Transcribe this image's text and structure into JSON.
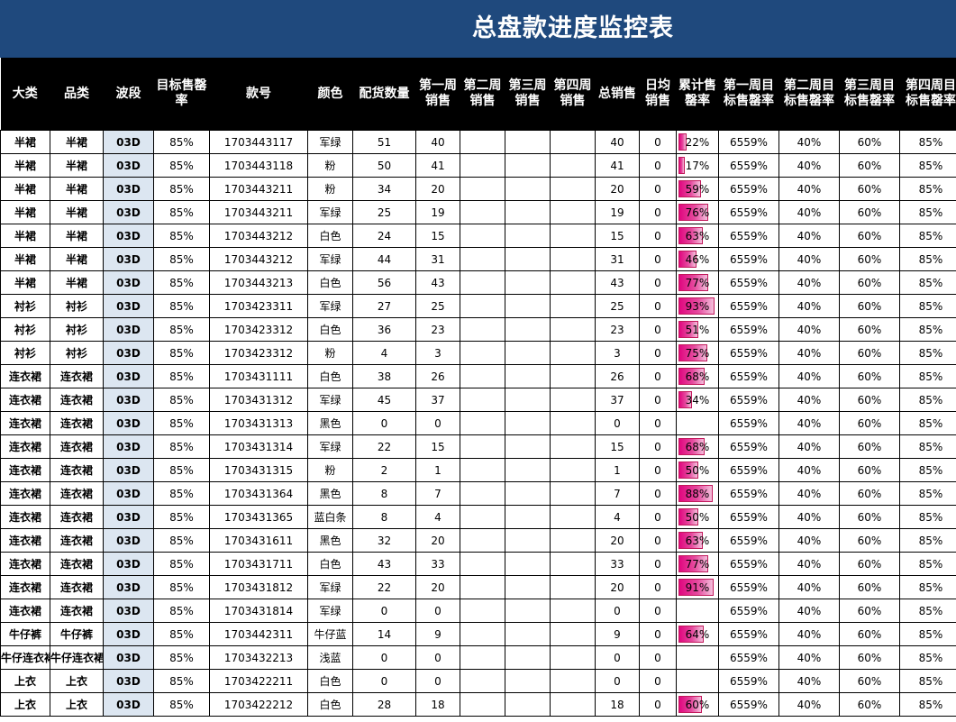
{
  "title": "总盘款进度监控表",
  "colors": {
    "header_bg": "#1f497d",
    "column_header_bg": "#000000",
    "wave_cell_bg": "#dce6f1",
    "databar": "#e0077f"
  },
  "columns": [
    "大类",
    "品类",
    "波段",
    "目标售罄率",
    "款号",
    "颜色",
    "配货数量",
    "第一周销售",
    "第二周销售",
    "第三周销售",
    "第四周销售",
    "总销售",
    "日均销售",
    "累计售罄率",
    "第一周目标售罄率",
    "第二周目标售罄率",
    "第三周目标售罄率",
    "第四周目标售罄率"
  ],
  "rows": [
    {
      "cat": "半裙",
      "sub": "半裙",
      "wave": "03D",
      "target": "85%",
      "sku": "1703443117",
      "color": "军绿",
      "qty": "51",
      "w1": "40",
      "w2": "",
      "w3": "",
      "w4": "",
      "total": "40",
      "daily": "0",
      "rate": "22%",
      "rate_value": 0.22,
      "t1": "6559%",
      "t2": "40%",
      "t3": "60%",
      "t4": "85%"
    },
    {
      "cat": "半裙",
      "sub": "半裙",
      "wave": "03D",
      "target": "85%",
      "sku": "1703443118",
      "color": "粉",
      "qty": "50",
      "w1": "41",
      "w2": "",
      "w3": "",
      "w4": "",
      "total": "41",
      "daily": "0",
      "rate": "17%",
      "rate_value": 0.17,
      "t1": "6559%",
      "t2": "40%",
      "t3": "60%",
      "t4": "85%"
    },
    {
      "cat": "半裙",
      "sub": "半裙",
      "wave": "03D",
      "target": "85%",
      "sku": "1703443211",
      "color": "粉",
      "qty": "34",
      "w1": "20",
      "w2": "",
      "w3": "",
      "w4": "",
      "total": "20",
      "daily": "0",
      "rate": "59%",
      "rate_value": 0.59,
      "t1": "6559%",
      "t2": "40%",
      "t3": "60%",
      "t4": "85%"
    },
    {
      "cat": "半裙",
      "sub": "半裙",
      "wave": "03D",
      "target": "85%",
      "sku": "1703443211",
      "color": "军绿",
      "qty": "25",
      "w1": "19",
      "w2": "",
      "w3": "",
      "w4": "",
      "total": "19",
      "daily": "0",
      "rate": "76%",
      "rate_value": 0.76,
      "t1": "6559%",
      "t2": "40%",
      "t3": "60%",
      "t4": "85%"
    },
    {
      "cat": "半裙",
      "sub": "半裙",
      "wave": "03D",
      "target": "85%",
      "sku": "1703443212",
      "color": "白色",
      "qty": "24",
      "w1": "15",
      "w2": "",
      "w3": "",
      "w4": "",
      "total": "15",
      "daily": "0",
      "rate": "63%",
      "rate_value": 0.63,
      "t1": "6559%",
      "t2": "40%",
      "t3": "60%",
      "t4": "85%"
    },
    {
      "cat": "半裙",
      "sub": "半裙",
      "wave": "03D",
      "target": "85%",
      "sku": "1703443212",
      "color": "军绿",
      "qty": "44",
      "w1": "31",
      "w2": "",
      "w3": "",
      "w4": "",
      "total": "31",
      "daily": "0",
      "rate": "46%",
      "rate_value": 0.46,
      "t1": "6559%",
      "t2": "40%",
      "t3": "60%",
      "t4": "85%"
    },
    {
      "cat": "半裙",
      "sub": "半裙",
      "wave": "03D",
      "target": "85%",
      "sku": "1703443213",
      "color": "白色",
      "qty": "56",
      "w1": "43",
      "w2": "",
      "w3": "",
      "w4": "",
      "total": "43",
      "daily": "0",
      "rate": "77%",
      "rate_value": 0.77,
      "t1": "6559%",
      "t2": "40%",
      "t3": "60%",
      "t4": "85%"
    },
    {
      "cat": "衬衫",
      "sub": "衬衫",
      "wave": "03D",
      "target": "85%",
      "sku": "1703423311",
      "color": "军绿",
      "qty": "27",
      "w1": "25",
      "w2": "",
      "w3": "",
      "w4": "",
      "total": "25",
      "daily": "0",
      "rate": "93%",
      "rate_value": 0.93,
      "t1": "6559%",
      "t2": "40%",
      "t3": "60%",
      "t4": "85%"
    },
    {
      "cat": "衬衫",
      "sub": "衬衫",
      "wave": "03D",
      "target": "85%",
      "sku": "1703423312",
      "color": "白色",
      "qty": "36",
      "w1": "23",
      "w2": "",
      "w3": "",
      "w4": "",
      "total": "23",
      "daily": "0",
      "rate": "51%",
      "rate_value": 0.51,
      "t1": "6559%",
      "t2": "40%",
      "t3": "60%",
      "t4": "85%"
    },
    {
      "cat": "衬衫",
      "sub": "衬衫",
      "wave": "03D",
      "target": "85%",
      "sku": "1703423312",
      "color": "粉",
      "qty": "4",
      "w1": "3",
      "w2": "",
      "w3": "",
      "w4": "",
      "total": "3",
      "daily": "0",
      "rate": "75%",
      "rate_value": 0.75,
      "t1": "6559%",
      "t2": "40%",
      "t3": "60%",
      "t4": "85%"
    },
    {
      "cat": "连衣裙",
      "sub": "连衣裙",
      "wave": "03D",
      "target": "85%",
      "sku": "1703431111",
      "color": "白色",
      "qty": "38",
      "w1": "26",
      "w2": "",
      "w3": "",
      "w4": "",
      "total": "26",
      "daily": "0",
      "rate": "68%",
      "rate_value": 0.68,
      "t1": "6559%",
      "t2": "40%",
      "t3": "60%",
      "t4": "85%"
    },
    {
      "cat": "连衣裙",
      "sub": "连衣裙",
      "wave": "03D",
      "target": "85%",
      "sku": "1703431312",
      "color": "军绿",
      "qty": "45",
      "w1": "37",
      "w2": "",
      "w3": "",
      "w4": "",
      "total": "37",
      "daily": "0",
      "rate": "34%",
      "rate_value": 0.34,
      "t1": "6559%",
      "t2": "40%",
      "t3": "60%",
      "t4": "85%"
    },
    {
      "cat": "连衣裙",
      "sub": "连衣裙",
      "wave": "03D",
      "target": "85%",
      "sku": "1703431313",
      "color": "黑色",
      "qty": "0",
      "w1": "0",
      "w2": "",
      "w3": "",
      "w4": "",
      "total": "0",
      "daily": "0",
      "rate": "",
      "rate_value": 0,
      "t1": "6559%",
      "t2": "40%",
      "t3": "60%",
      "t4": "85%"
    },
    {
      "cat": "连衣裙",
      "sub": "连衣裙",
      "wave": "03D",
      "target": "85%",
      "sku": "1703431314",
      "color": "军绿",
      "qty": "22",
      "w1": "15",
      "w2": "",
      "w3": "",
      "w4": "",
      "total": "15",
      "daily": "0",
      "rate": "68%",
      "rate_value": 0.68,
      "t1": "6559%",
      "t2": "40%",
      "t3": "60%",
      "t4": "85%"
    },
    {
      "cat": "连衣裙",
      "sub": "连衣裙",
      "wave": "03D",
      "target": "85%",
      "sku": "1703431315",
      "color": "粉",
      "qty": "2",
      "w1": "1",
      "w2": "",
      "w3": "",
      "w4": "",
      "total": "1",
      "daily": "0",
      "rate": "50%",
      "rate_value": 0.5,
      "t1": "6559%",
      "t2": "40%",
      "t3": "60%",
      "t4": "85%"
    },
    {
      "cat": "连衣裙",
      "sub": "连衣裙",
      "wave": "03D",
      "target": "85%",
      "sku": "1703431364",
      "color": "黑色",
      "qty": "8",
      "w1": "7",
      "w2": "",
      "w3": "",
      "w4": "",
      "total": "7",
      "daily": "0",
      "rate": "88%",
      "rate_value": 0.88,
      "t1": "6559%",
      "t2": "40%",
      "t3": "60%",
      "t4": "85%"
    },
    {
      "cat": "连衣裙",
      "sub": "连衣裙",
      "wave": "03D",
      "target": "85%",
      "sku": "1703431365",
      "color": "蓝白条",
      "qty": "8",
      "w1": "4",
      "w2": "",
      "w3": "",
      "w4": "",
      "total": "4",
      "daily": "0",
      "rate": "50%",
      "rate_value": 0.5,
      "t1": "6559%",
      "t2": "40%",
      "t3": "60%",
      "t4": "85%"
    },
    {
      "cat": "连衣裙",
      "sub": "连衣裙",
      "wave": "03D",
      "target": "85%",
      "sku": "1703431611",
      "color": "黑色",
      "qty": "32",
      "w1": "20",
      "w2": "",
      "w3": "",
      "w4": "",
      "total": "20",
      "daily": "0",
      "rate": "63%",
      "rate_value": 0.63,
      "t1": "6559%",
      "t2": "40%",
      "t3": "60%",
      "t4": "85%"
    },
    {
      "cat": "连衣裙",
      "sub": "连衣裙",
      "wave": "03D",
      "target": "85%",
      "sku": "1703431711",
      "color": "白色",
      "qty": "43",
      "w1": "33",
      "w2": "",
      "w3": "",
      "w4": "",
      "total": "33",
      "daily": "0",
      "rate": "77%",
      "rate_value": 0.77,
      "t1": "6559%",
      "t2": "40%",
      "t3": "60%",
      "t4": "85%"
    },
    {
      "cat": "连衣裙",
      "sub": "连衣裙",
      "wave": "03D",
      "target": "85%",
      "sku": "1703431812",
      "color": "军绿",
      "qty": "22",
      "w1": "20",
      "w2": "",
      "w3": "",
      "w4": "",
      "total": "20",
      "daily": "0",
      "rate": "91%",
      "rate_value": 0.91,
      "t1": "6559%",
      "t2": "40%",
      "t3": "60%",
      "t4": "85%"
    },
    {
      "cat": "连衣裙",
      "sub": "连衣裙",
      "wave": "03D",
      "target": "85%",
      "sku": "1703431814",
      "color": "军绿",
      "qty": "0",
      "w1": "0",
      "w2": "",
      "w3": "",
      "w4": "",
      "total": "0",
      "daily": "0",
      "rate": "",
      "rate_value": 0,
      "t1": "6559%",
      "t2": "40%",
      "t3": "60%",
      "t4": "85%"
    },
    {
      "cat": "牛仔裤",
      "sub": "牛仔裤",
      "wave": "03D",
      "target": "85%",
      "sku": "1703442311",
      "color": "牛仔蓝",
      "qty": "14",
      "w1": "9",
      "w2": "",
      "w3": "",
      "w4": "",
      "total": "9",
      "daily": "0",
      "rate": "64%",
      "rate_value": 0.64,
      "t1": "6559%",
      "t2": "40%",
      "t3": "60%",
      "t4": "85%"
    },
    {
      "cat": "牛仔连衣裙",
      "sub": "牛仔连衣裙",
      "wave": "03D",
      "target": "85%",
      "sku": "1703432213",
      "color": "浅蓝",
      "qty": "0",
      "w1": "0",
      "w2": "",
      "w3": "",
      "w4": "",
      "total": "0",
      "daily": "0",
      "rate": "",
      "rate_value": 0,
      "t1": "6559%",
      "t2": "40%",
      "t3": "60%",
      "t4": "85%"
    },
    {
      "cat": "上衣",
      "sub": "上衣",
      "wave": "03D",
      "target": "85%",
      "sku": "1703422211",
      "color": "白色",
      "qty": "0",
      "w1": "0",
      "w2": "",
      "w3": "",
      "w4": "",
      "total": "0",
      "daily": "0",
      "rate": "",
      "rate_value": 0,
      "t1": "6559%",
      "t2": "40%",
      "t3": "60%",
      "t4": "85%"
    },
    {
      "cat": "上衣",
      "sub": "上衣",
      "wave": "03D",
      "target": "85%",
      "sku": "1703422212",
      "color": "白色",
      "qty": "28",
      "w1": "18",
      "w2": "",
      "w3": "",
      "w4": "",
      "total": "18",
      "daily": "0",
      "rate": "60%",
      "rate_value": 0.6,
      "t1": "6559%",
      "t2": "40%",
      "t3": "60%",
      "t4": "85%"
    }
  ]
}
